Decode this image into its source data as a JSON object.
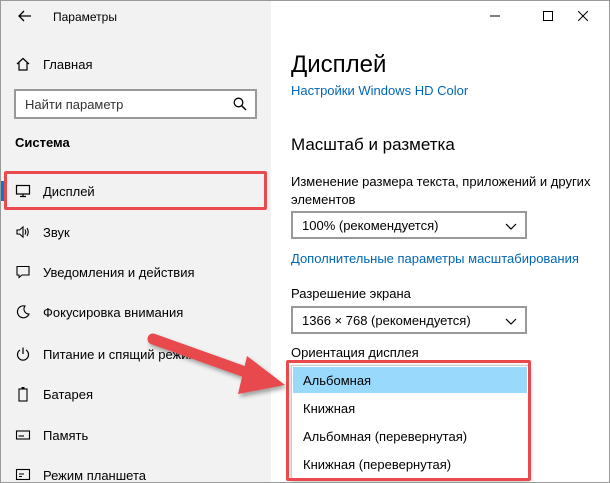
{
  "window": {
    "title": "Параметры",
    "controls": [
      "minimize-icon",
      "maximize-icon",
      "close-icon"
    ]
  },
  "sidebar": {
    "home_label": "Главная",
    "search_placeholder": "Найти параметр",
    "section_title": "Система",
    "items": [
      {
        "label": "Дисплей",
        "icon": "monitor-icon"
      },
      {
        "label": "Звук",
        "icon": "speaker-icon"
      },
      {
        "label": "Уведомления и действия",
        "icon": "notification-icon"
      },
      {
        "label": "Фокусировка внимания",
        "icon": "moon-icon"
      },
      {
        "label": "Питание и спящий режим",
        "icon": "power-icon"
      },
      {
        "label": "Батарея",
        "icon": "battery-icon"
      },
      {
        "label": "Память",
        "icon": "storage-icon"
      },
      {
        "label": "Режим планшета",
        "icon": "tablet-icon"
      }
    ]
  },
  "main": {
    "title": "Дисплей",
    "hd_color_link": "Настройки Windows HD Color",
    "scale_section_title": "Масштаб и разметка",
    "scale_label": "Изменение размера текста, приложений и других элементов",
    "scale_value": "100% (рекомендуется)",
    "advanced_scaling_link": "Дополнительные параметры масштабирования",
    "resolution_label": "Разрешение экрана",
    "resolution_value": "1366 × 768 (рекомендуется)",
    "orientation_label": "Ориентация дисплея",
    "orientation_options": [
      "Альбомная",
      "Книжная",
      "Альбомная (перевернутая)",
      "Книжная (перевернутая)"
    ],
    "orientation_selected": "Альбомная"
  },
  "colors": {
    "accent": "#0078d7",
    "link": "#0067b8",
    "highlight": "#e84a4d",
    "selected_option": "#99d9fb",
    "sidebar_bg": "#f2f2f2"
  }
}
